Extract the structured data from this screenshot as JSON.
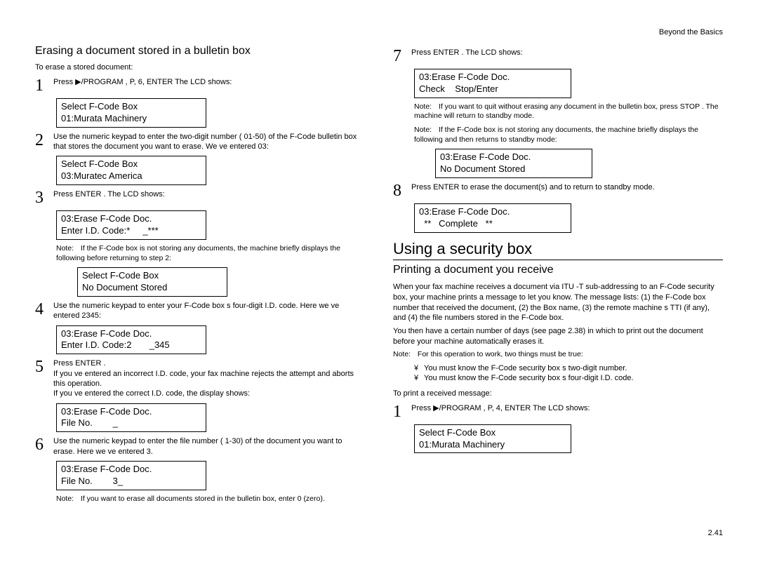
{
  "header": {
    "right": "Beyond the Basics"
  },
  "left": {
    "h2": "Erasing a document stored in a bulletin box",
    "intro": "To erase a stored document:",
    "step1": "Press ▶/PROGRAM , P, 6, ENTER  The LCD shows:",
    "lcd1": "Select F-Code Box\n01:Murata Machinery",
    "step2": "Use the numeric keypad to enter the two-digit number (    01-50) of the F-Code bulletin box that stores the document you want to erase. We ve entered    03:",
    "lcd2": "Select F-Code Box\n03:Muratec America",
    "step3": "Press ENTER . The LCD shows:",
    "lcd3": "03:Erase F-Code Doc.\nEnter I.D. Code:*     _***",
    "note3": "If the F-Code box is not storing any documents, the machine briefly displays the following before returning to step 2:",
    "lcd3b": "Select F-Code Box\nNo Document Stored",
    "step4": "Use the numeric keypad to enter your F-Code box s four-digit    I.D. code. Here we ve entered  2345:",
    "lcd4": "03:Erase F-Code Doc.\nEnter I.D. Code:2       _345",
    "step5a": "Press ENTER .",
    "step5b": "If you ve entered an incorrect   I.D. code, your fax machine rejects the attempt and aborts this operation.",
    "step5c": "If you ve entered the correct   I.D. code, the display shows:",
    "lcd5": "03:Erase F-Code Doc.\nFile No.        _",
    "step6": "Use the numeric keypad to enter the file number (    1-30) of the document you want to erase. Here we ve entered 3.",
    "lcd6": "03:Erase F-Code Doc.\nFile No.        3_",
    "note6": "If you want to erase   all  documents stored in the bulletin box, enter    0 (zero)."
  },
  "right": {
    "step7": "Press ENTER . The LCD shows:",
    "lcd7": "03:Erase F-Code Doc.\nCheck    Stop/Enter",
    "note7a": "If you want to quit without erasing     any document in the bulletin box, press STOP . The machine will return to standby mode.",
    "note7b": "If the F-Code box is not storing any documents, the machine briefly displays the following and then returns to standby mode:",
    "lcd7b": "03:Erase F-Code Doc.\nNo Document Stored",
    "step8": "Press ENTER  to erase the document(s) and to return to standby mode.",
    "lcd8": "03:Erase F-Code Doc.\n  **   Complete   **",
    "h1": "Using a security box",
    "h2b": "Printing a document you receive",
    "para1": "When your fax machine receives a document via    ITU -T sub-addressing to an F-Code security box, your machine prints a message to let you know. The message lists:    (1) the F-Code box number that received the document,    (2) the Box name,  (3)  the remote machine s   TTI  (if any), and   (4)  the file numbers stored in the F-Code box.",
    "para2": "You then have a certain number of days (see page 2.38) in which to print out the document before your machine automatically erases it.",
    "noteB": "For this operation to work, two things must be true:",
    "bullet1": "You must know the F-Code security box s two-digit number.",
    "bullet2": "You must know the F-Code security box s four-digit    I.D. code.",
    "intro2": "To print a received message:",
    "stepB1": "Press ▶/PROGRAM , P, 4, ENTER   The LCD shows:",
    "lcdB1": "Select F-Code Box\n01:Murata Machinery"
  },
  "pagenum": "2.41"
}
